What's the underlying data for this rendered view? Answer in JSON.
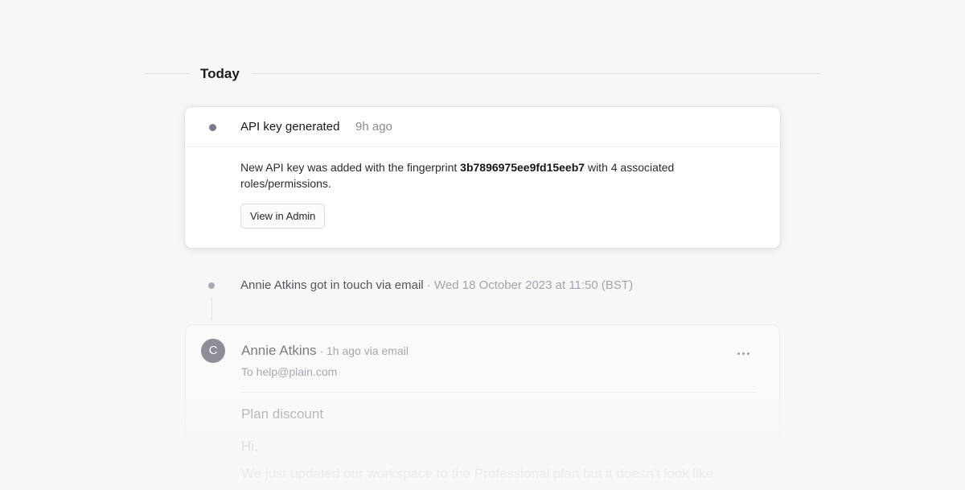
{
  "section": {
    "title": "Today"
  },
  "api_event": {
    "title": "API key generated",
    "time": "9h ago",
    "body_prefix": "New API key was added with the fingerprint ",
    "fingerprint": "3b7896975ee9fd15eeb7",
    "body_suffix": " with 4 associated roles/permissions.",
    "button_label": "View in Admin"
  },
  "contact_event": {
    "name": "Annie Atkins",
    "action": " got in touch via email",
    "separator": " · ",
    "timestamp": "Wed 18 October 2023 at 11:50 (BST)"
  },
  "email": {
    "avatar_initial": "C",
    "from_name": "Annie Atkins",
    "meta": " · 1h ago via email",
    "to": "To help@plain.com",
    "subject": "Plan discount",
    "greeting": "Hi,",
    "body_preview": "We just updated our workspace to the Professional plan but it doesn't look like"
  }
}
